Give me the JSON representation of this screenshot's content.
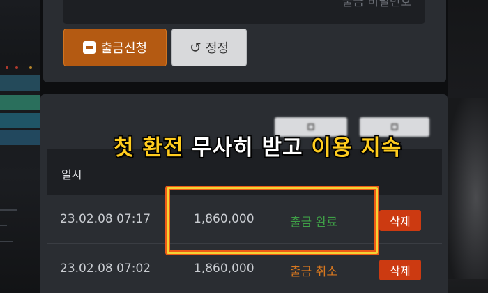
{
  "withdraw_form": {
    "password_placeholder": "출금 비밀번호",
    "withdraw_button": "출금신청",
    "correct_button": "정정"
  },
  "history": {
    "columns": {
      "date": "일시"
    },
    "rows": [
      {
        "date": "23.02.08 07:17",
        "amount": "1,860,000",
        "status": "출금 완료",
        "delete_label": "삭제"
      },
      {
        "date": "23.02.08 07:02",
        "amount": "1,860,000",
        "status": "출금 취소",
        "delete_label": "삭제"
      }
    ]
  },
  "caption": {
    "part1": "첫 환전",
    "part2": "무사히 받고",
    "part3": "이용 지속"
  },
  "colors": {
    "status_done": "#3fa047",
    "status_cancel": "#d9781f",
    "withdraw_button": "#b45a12",
    "delete_button": "#cc3a11",
    "highlight": "#f3d235"
  }
}
